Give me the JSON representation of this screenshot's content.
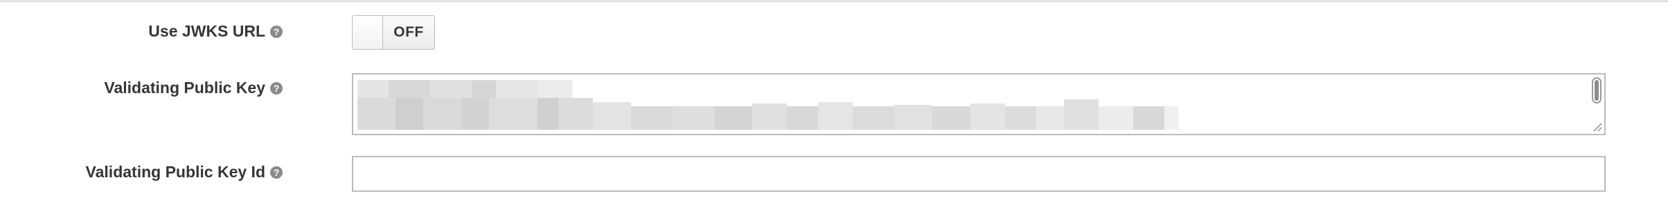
{
  "form": {
    "use_jwks_url": {
      "label": "Use JWKS URL",
      "help_icon": "question-circle-icon",
      "toggle_state": "OFF"
    },
    "validating_public_key": {
      "label": "Validating Public Key",
      "help_icon": "question-circle-icon",
      "value_redacted": true
    },
    "validating_public_key_id": {
      "label": "Validating Public Key Id",
      "help_icon": "question-circle-icon",
      "value": "",
      "placeholder": ""
    }
  },
  "colors": {
    "label_text": "#363636",
    "border": "#bbbbbb",
    "help_icon": "#8a8a8a",
    "redaction": "#dcdcdc"
  }
}
